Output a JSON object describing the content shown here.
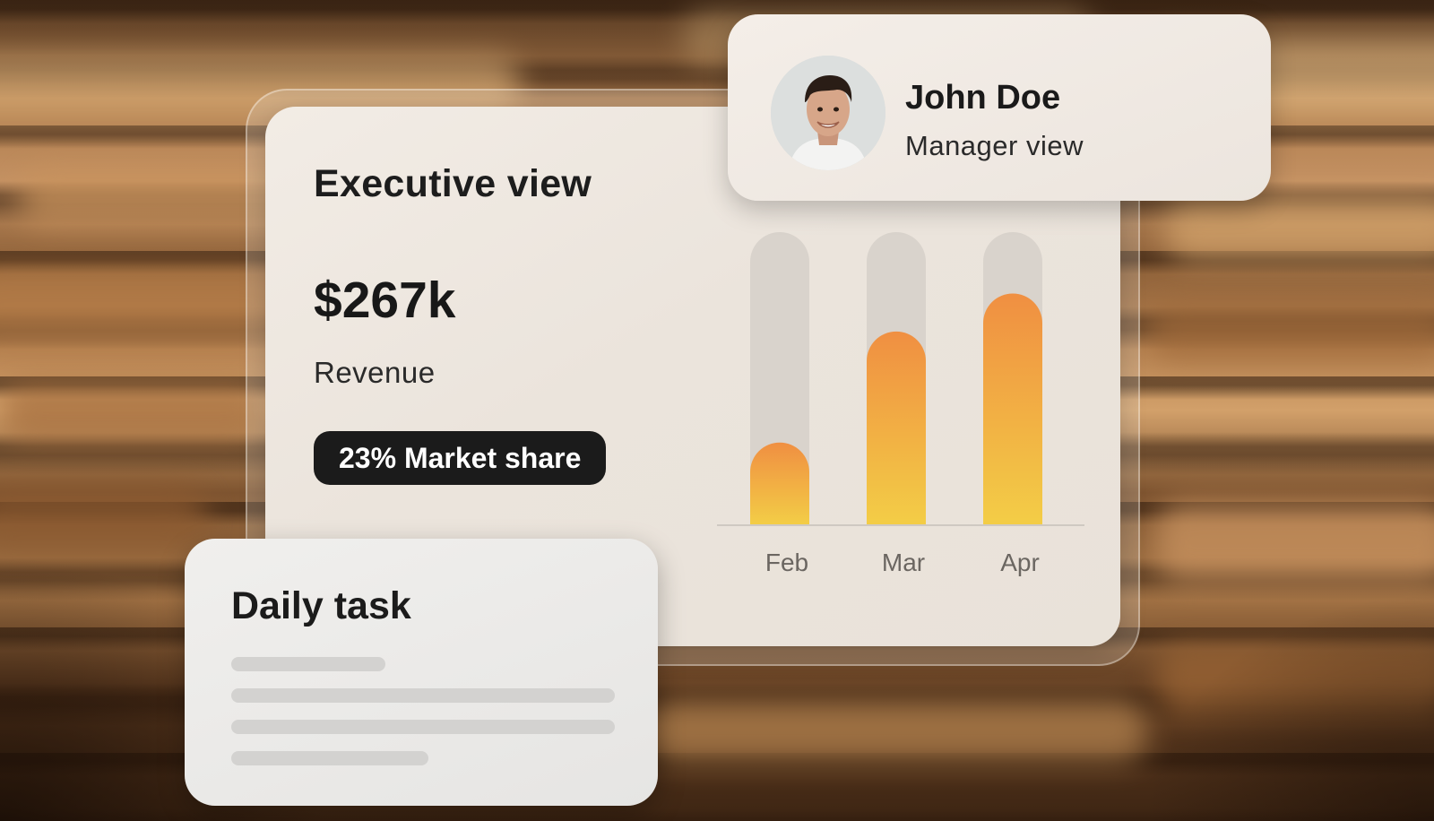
{
  "executive": {
    "title": "Executive view",
    "revenue_value": "$267k",
    "revenue_label": "Revenue",
    "market_share_badge": "23% Market share"
  },
  "profile": {
    "name": "John Doe",
    "role": "Manager view"
  },
  "task": {
    "title": "Daily task"
  },
  "chart_data": {
    "type": "bar",
    "categories": [
      "Feb",
      "Mar",
      "Apr"
    ],
    "values": [
      0.28,
      0.66,
      0.79
    ],
    "ylim": [
      0,
      1
    ],
    "grid": false,
    "colors": {
      "track": "#d9d3cc",
      "bar_top": "#f08f42",
      "bar_bottom": "#f3cd46",
      "baseline": "#cfc9c2"
    }
  }
}
